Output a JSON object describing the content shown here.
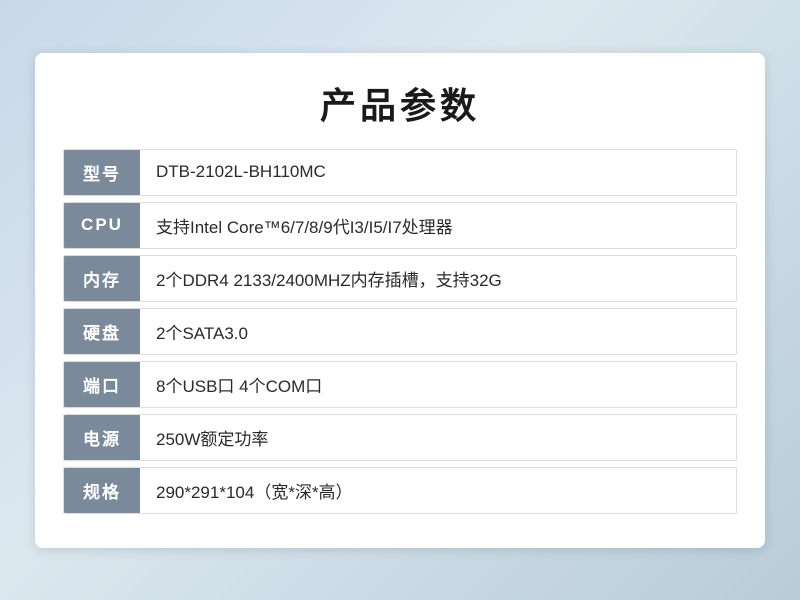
{
  "page": {
    "title": "产品参数",
    "rows": [
      {
        "label": "型号",
        "value": " DTB-2102L-BH110MC"
      },
      {
        "label": "CPU",
        "value": "支持Intel Core™6/7/8/9代I3/I5/I7处理器"
      },
      {
        "label": "内存",
        "value": "2个DDR4 2133/2400MHZ内存插槽，支持32G"
      },
      {
        "label": "硬盘",
        "value": "2个SATA3.0"
      },
      {
        "label": "端口",
        "value": "8个USB口 4个COM口"
      },
      {
        "label": "电源",
        "value": "250W额定功率"
      },
      {
        "label": "规格",
        "value": "290*291*104（宽*深*高）"
      }
    ]
  }
}
